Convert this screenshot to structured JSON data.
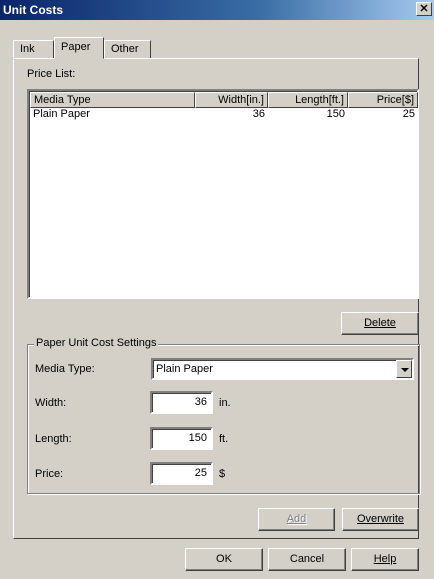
{
  "window": {
    "title": "Unit Costs",
    "close_glyph": "✕"
  },
  "tabs": [
    {
      "label": "Ink",
      "active": false
    },
    {
      "label": "Paper",
      "active": true
    },
    {
      "label": "Other",
      "active": false
    }
  ],
  "price_list": {
    "label": "Price List:",
    "columns": [
      "Media Type",
      "Width[in.]",
      "Length[ft.]",
      "Price[$]"
    ],
    "rows": [
      {
        "media_type": "Plain Paper",
        "width": "36",
        "length": "150",
        "price": "25"
      }
    ]
  },
  "buttons": {
    "delete": "Delete",
    "add": "Add",
    "overwrite": "Overwrite",
    "ok": "OK",
    "cancel": "Cancel",
    "help": "Help"
  },
  "settings": {
    "group_title": "Paper Unit Cost Settings",
    "media_type_label": "Media Type:",
    "media_type_value": "Plain Paper",
    "width_label": "Width:",
    "width_value": "36",
    "width_unit": "in.",
    "length_label": "Length:",
    "length_value": "150",
    "length_unit": "ft.",
    "price_label": "Price:",
    "price_value": "25",
    "price_unit": "$"
  },
  "colors": {
    "title_bar": "#0a246a",
    "dialog_face": "#d4d0c8",
    "disabled_text": "#808080"
  },
  "icons": {
    "close": "close-icon",
    "dropdown": "chevron-down-icon"
  }
}
